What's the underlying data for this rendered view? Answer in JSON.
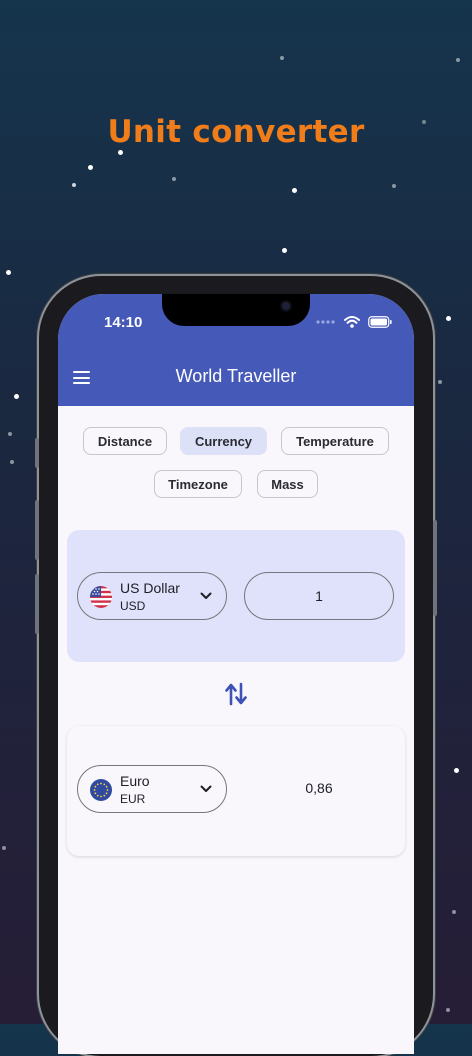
{
  "headline": "Unit converter",
  "status": {
    "time": "14:10"
  },
  "app": {
    "title": "World Traveller"
  },
  "categories": [
    {
      "label": "Distance",
      "selected": false
    },
    {
      "label": "Currency",
      "selected": true
    },
    {
      "label": "Temperature",
      "selected": false
    },
    {
      "label": "Timezone",
      "selected": false
    },
    {
      "label": "Mass",
      "selected": false
    }
  ],
  "converter": {
    "from": {
      "name": "US Dollar",
      "code": "USD",
      "amount": "1"
    },
    "to": {
      "name": "Euro",
      "code": "EUR",
      "result": "0,86"
    }
  },
  "colors": {
    "accent": "#f07d1a",
    "appbar": "#4559b8",
    "selected_chip": "#dde1f7",
    "from_card": "#dfe2fa"
  },
  "icons": {
    "menu": "menu-icon",
    "swap": "swap-vertical-icon",
    "dropdown": "chevron-down-icon",
    "wifi": "wifi-icon",
    "battery": "battery-icon",
    "cellular": "cellular-signal-icon"
  }
}
